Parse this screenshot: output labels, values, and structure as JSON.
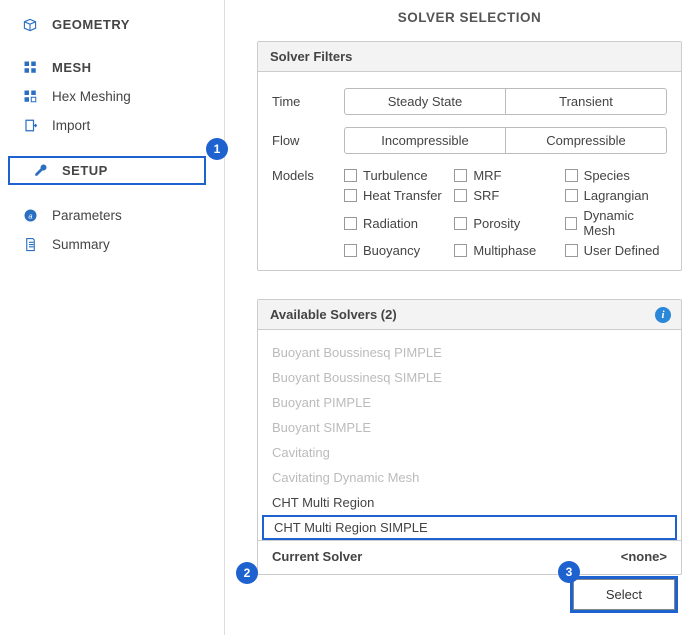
{
  "sidebar": {
    "geometry": "GEOMETRY",
    "mesh": "MESH",
    "hex_meshing": "Hex Meshing",
    "import": "Import",
    "setup": "SETUP",
    "parameters": "Parameters",
    "summary": "Summary"
  },
  "callouts": {
    "c1": "1",
    "c2": "2",
    "c3": "3"
  },
  "main": {
    "title": "SOLVER SELECTION",
    "filters_title": "Solver Filters",
    "time_label": "Time",
    "time_opts": [
      "Steady State",
      "Transient"
    ],
    "flow_label": "Flow",
    "flow_opts": [
      "Incompressible",
      "Compressible"
    ],
    "models_label": "Models",
    "models": [
      "Turbulence",
      "MRF",
      "Species",
      "Heat Transfer",
      "SRF",
      "Lagrangian",
      "Radiation",
      "Porosity",
      "Dynamic Mesh",
      "Buoyancy",
      "Multiphase",
      "User Defined"
    ],
    "avail_title": "Available Solvers (2)",
    "solvers": [
      {
        "name": "Buoyant Boussinesq PIMPLE",
        "enabled": false
      },
      {
        "name": "Buoyant Boussinesq SIMPLE",
        "enabled": false
      },
      {
        "name": "Buoyant PIMPLE",
        "enabled": false
      },
      {
        "name": "Buoyant SIMPLE",
        "enabled": false
      },
      {
        "name": "Cavitating",
        "enabled": false
      },
      {
        "name": "Cavitating Dynamic Mesh",
        "enabled": false
      },
      {
        "name": "CHT Multi Region",
        "enabled": true
      },
      {
        "name": "CHT Multi Region SIMPLE",
        "enabled": true,
        "selected": true
      }
    ],
    "current_label": "Current Solver",
    "current_value": "<none>",
    "select_btn": "Select"
  }
}
